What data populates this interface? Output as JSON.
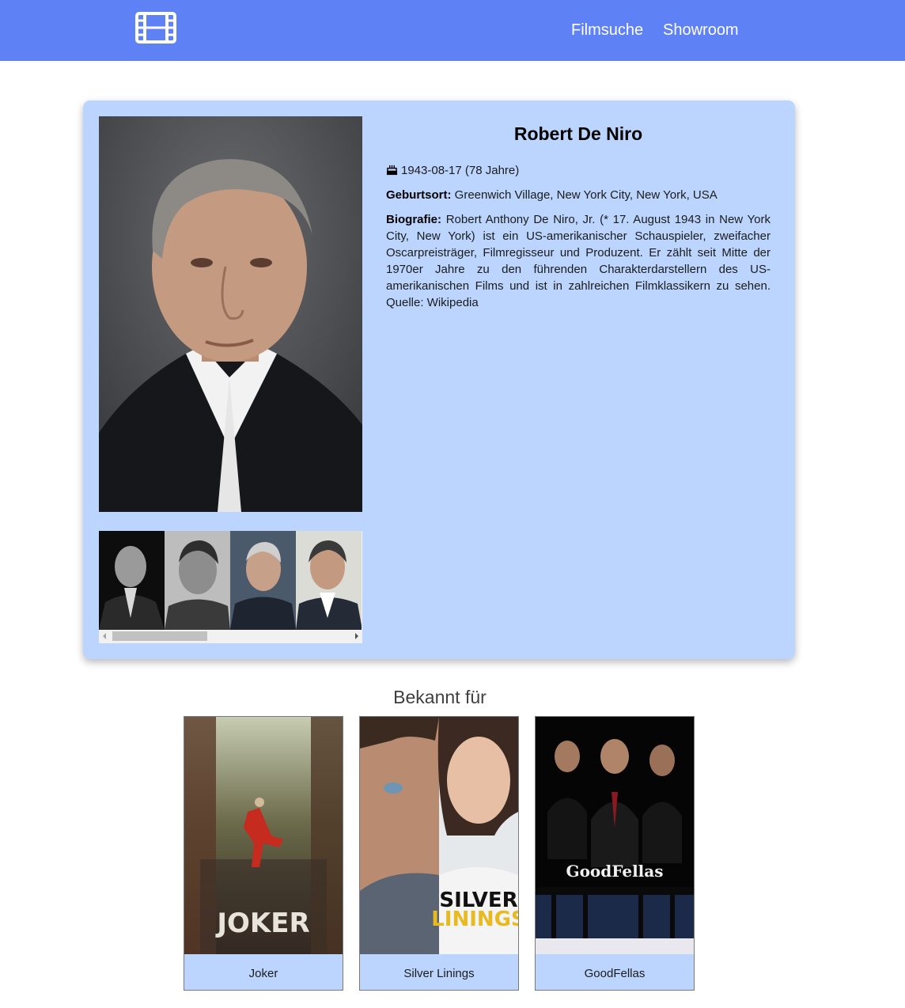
{
  "nav": {
    "logo_icon": "film-icon",
    "links": [
      "Filmsuche",
      "Showroom"
    ]
  },
  "colors": {
    "navbar": "#5f81f6",
    "card_background": "#bbd5fe",
    "movie_caption_background": "#bbd5fe"
  },
  "person": {
    "name": "Robert De Niro",
    "birth_icon": "birthday-cake-icon",
    "birth": "1943-08-17 (78 Jahre)",
    "birthplace_label": "Geburtsort:",
    "birthplace": "Greenwich Village, New York City, New York, USA",
    "bio_label": "Biografie:",
    "bio": "Robert Anthony De Niro, Jr. (* 17. August 1943 in New York City, New York) ist ein US-amerikanischer Schauspieler, zweifacher Oscarpreisträger, Filmregisseur und Produzent. Er zählt seit Mitte der 1970er Jahre zu den führenden Charakterdarstellern des US-amerikanischen Films und ist in zahlreichen Filmklassikern zu sehen. Quelle: Wikipedia"
  },
  "known_for": {
    "title": "Bekannt für",
    "movies": [
      {
        "title": "Joker",
        "poster_text": "JOKER"
      },
      {
        "title": "Silver Linings",
        "poster_text": "SILVER LININGS"
      },
      {
        "title": "GoodFellas",
        "poster_text": "GoodFellas"
      }
    ]
  }
}
